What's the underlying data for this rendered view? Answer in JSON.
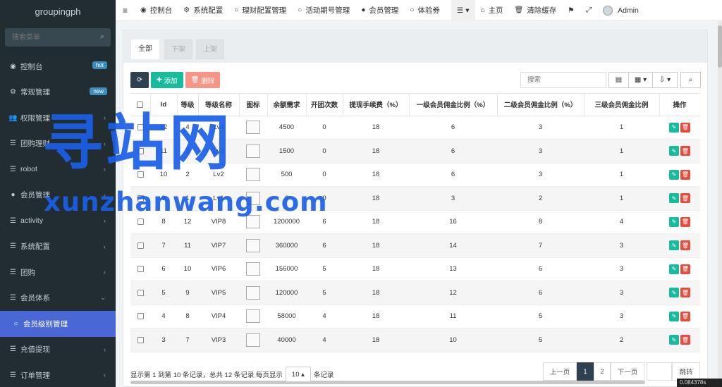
{
  "sidebar": {
    "logo": "groupingph",
    "search_placeholder": "搜索菜单",
    "items": [
      {
        "label": "控制台",
        "icon": "dashboard-icon",
        "glyph": "◉",
        "badge": "hot"
      },
      {
        "label": "常规管理",
        "icon": "cogs-icon",
        "glyph": "⚙",
        "badge": "new"
      },
      {
        "label": "权限管理",
        "icon": "group-icon",
        "glyph": "👥",
        "chevron": "‹"
      },
      {
        "label": "团购理财",
        "icon": "list-icon",
        "glyph": "☰",
        "chevron": "‹"
      },
      {
        "label": "robot",
        "icon": "list-icon",
        "glyph": "☰",
        "chevron": "‹"
      },
      {
        "label": "会员管理",
        "icon": "user-circle-icon",
        "glyph": "●",
        "chevron": "‹"
      },
      {
        "label": "activity",
        "icon": "list-icon",
        "glyph": "☰",
        "chevron": "‹"
      },
      {
        "label": "系统配置",
        "icon": "list-icon",
        "glyph": "☰",
        "chevron": "‹"
      },
      {
        "label": "团购",
        "icon": "list-icon",
        "glyph": "☰",
        "chevron": "‹"
      },
      {
        "label": "会员体系",
        "icon": "list-icon",
        "glyph": "☰",
        "chevron": "⌄"
      },
      {
        "label": "会员级别管理",
        "icon": "circle-o-icon",
        "glyph": "○",
        "active": true
      },
      {
        "label": "充值提现",
        "icon": "list-icon",
        "glyph": "☰",
        "chevron": "‹"
      },
      {
        "label": "订单管理",
        "icon": "list-icon",
        "glyph": "☰",
        "chevron": "‹"
      }
    ]
  },
  "topnav": {
    "items": [
      {
        "label": "控制台",
        "icon": "dashboard-icon",
        "glyph": "◉"
      },
      {
        "label": "系统配置",
        "icon": "gear-icon",
        "glyph": "⚙"
      },
      {
        "label": "理财配置管理",
        "icon": "circle-o-icon",
        "glyph": "○"
      },
      {
        "label": "活动期号管理",
        "icon": "circle-o-icon",
        "glyph": "○"
      },
      {
        "label": "会员管理",
        "icon": "user-icon",
        "glyph": "●"
      },
      {
        "label": "体验券",
        "icon": "circle-o-icon",
        "glyph": "○"
      }
    ],
    "home": "主页",
    "clear_cache": "清除缓存",
    "admin": "Admin"
  },
  "tabs": {
    "all": "全部",
    "offline": "下架",
    "online": "上架"
  },
  "toolbar": {
    "add": "添加",
    "delete": "删除",
    "search_placeholder": "搜索"
  },
  "table": {
    "headers": [
      "Id",
      "等级",
      "等级名称",
      "图标",
      "余额需求",
      "开团次数",
      "提现手续费（%）",
      "一级会员佣金比例（%）",
      "二级会员佣金比例（%）",
      "三级会员佣金比例",
      "操作"
    ],
    "rows": [
      [
        "12",
        "4",
        "Lv4",
        "",
        "4500",
        "0",
        "18",
        "6",
        "3",
        "1"
      ],
      [
        "11",
        "3",
        "Lv3",
        "",
        "1500",
        "0",
        "18",
        "6",
        "3",
        "1"
      ],
      [
        "10",
        "2",
        "Lv2",
        "",
        "500",
        "0",
        "18",
        "6",
        "3",
        "1"
      ],
      [
        "9",
        "1",
        "Lv1",
        "",
        "0",
        "0",
        "18",
        "3",
        "2",
        "1"
      ],
      [
        "8",
        "12",
        "VIP8",
        "",
        "1200000",
        "6",
        "18",
        "16",
        "8",
        "4"
      ],
      [
        "7",
        "11",
        "VIP7",
        "",
        "360000",
        "6",
        "18",
        "14",
        "7",
        "3"
      ],
      [
        "6",
        "10",
        "VIP6",
        "",
        "156000",
        "5",
        "18",
        "13",
        "6",
        "3"
      ],
      [
        "5",
        "9",
        "VIP5",
        "",
        "120000",
        "5",
        "18",
        "12",
        "6",
        "3"
      ],
      [
        "4",
        "8",
        "VIP4",
        "",
        "58000",
        "4",
        "18",
        "11",
        "5",
        "3"
      ],
      [
        "3",
        "7",
        "VIP3",
        "",
        "40000",
        "4",
        "18",
        "10",
        "5",
        "2"
      ]
    ]
  },
  "footer": {
    "summary": "显示第 1 到第 10 条记录，总共 12 条记录 每页显示",
    "page_size": "10",
    "records_suffix": "条记录",
    "prev": "上一页",
    "page1": "1",
    "page2": "2",
    "next": "下一页",
    "go": "跳转"
  },
  "watermark": {
    "title": "寻站网",
    "url": "xunzhanwang.com"
  },
  "stamp": "0.084378s"
}
